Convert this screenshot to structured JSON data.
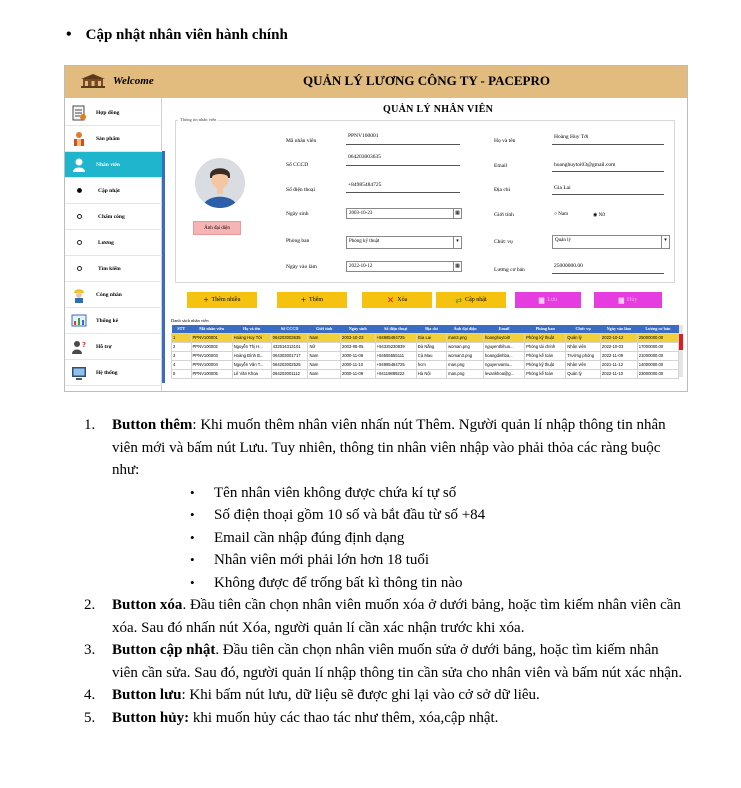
{
  "heading": {
    "bullet": "•",
    "text": "Cập nhật nhân viên hành chính"
  },
  "app": {
    "welcome": "Welcome",
    "title": "QUẢN LÝ LƯƠNG CÔNG TY - PACEPRO",
    "colors": {
      "top_bar": "#e2bb7f",
      "active_item": "#1fb5cc",
      "table_header": "#3b6cc3",
      "selected_row": "#f2d03b"
    },
    "sidebar": {
      "items": [
        {
          "label": "Hợp đồng",
          "icon": "contract-icon"
        },
        {
          "label": "Sản phẩm",
          "icon": "product-icon"
        },
        {
          "label": "Nhân viên",
          "icon": "employee-icon",
          "active": true
        },
        {
          "label": "Cập nhật",
          "sub": true,
          "selected": true
        },
        {
          "label": "Chấm công",
          "sub": true
        },
        {
          "label": "Lương",
          "sub": true
        },
        {
          "label": "Tìm kiếm",
          "sub": true
        },
        {
          "label": "Công nhân",
          "icon": "worker-icon"
        },
        {
          "label": "Thống kê",
          "icon": "statistics-icon"
        },
        {
          "label": "Hỗ trợ",
          "icon": "support-icon"
        },
        {
          "label": "Hệ thống",
          "icon": "system-icon"
        }
      ]
    },
    "main_title": "QUẢN LÝ NHÂN VIÊN",
    "info_caption": "Thông tin nhân viên",
    "avatar_button": "Ảnh đại diện",
    "fields": {
      "ma_nv": {
        "label": "Mã nhân viên",
        "value": "PPNV100001"
      },
      "cccd": {
        "label": "Số CCCD",
        "value": "064203003635"
      },
      "sdt": {
        "label": "Số điện thoại",
        "value": "+84985484725"
      },
      "ngay_sinh": {
        "label": "Ngày sinh",
        "value": "2003-10-23"
      },
      "phong_ban": {
        "label": "Phòng ban",
        "value": "Phòng kỹ thuật"
      },
      "ngay_vao_lam": {
        "label": "Ngày vào làm",
        "value": "2022-10-12"
      },
      "ho_ten": {
        "label": "Họ và tên",
        "value": "Hoàng Huy Tới"
      },
      "email": {
        "label": "Email",
        "value": "hoanghuytoi03@gmail.com"
      },
      "dia_chi": {
        "label": "Địa chỉ",
        "value": "Gia Lai"
      },
      "gioi_tinh": {
        "label": "Giới tính",
        "opt_male": "Nam",
        "opt_female": "Nữ",
        "selected": "Nữ"
      },
      "chuc_vu": {
        "label": "Chức vụ",
        "value": "Quản lý"
      },
      "luong": {
        "label": "Lương cơ bản",
        "value": "25000000.00"
      }
    },
    "buttons": {
      "them_nhieu": "Thêm nhiều",
      "them": "Thêm",
      "xoa": "Xóa",
      "cap_nhat": "Cập nhật",
      "luu": "Lưu",
      "huy": "Hủy"
    },
    "table_caption": "Danh sách nhân viên",
    "table": {
      "headers": [
        "STT",
        "Mã nhân viên",
        "Họ và tên",
        "Số CCCD",
        "Giới tính",
        "Ngày sinh",
        "Số điện thoại",
        "Địa chỉ",
        "Ảnh đại diện",
        "Email",
        "Phòng ban",
        "Chức vụ",
        "Ngày vào làm",
        "Lương cơ bản"
      ],
      "rows": [
        [
          "1",
          "PPNV100001",
          "Hoàng Huy Tới",
          "064203003635",
          "Nam",
          "2003-10-23",
          "+84985484725",
          "Gia Lai",
          "man3.png",
          "hoanghuytoi0",
          "Phòng kỹ thuật",
          "Quản lý",
          "2022-10-12",
          "25000000.00"
        ],
        [
          "2",
          "PPNV100002",
          "Nguyễn Thị H...",
          "432514313101",
          "Nữ",
          "2003-08-05",
          "+84325230839",
          "Đà Nẵng",
          "woman.png",
          "nguyenthihuo...",
          "Phòng tài chính",
          "Nhân viên",
          "2022-10-03",
          "17000000.00"
        ],
        [
          "3",
          "PPNV100003",
          "Hoàng Đình B...",
          "064303001717",
          "Nam",
          "2000-11-09",
          "+84555555111",
          "Cà Mau",
          "woman3.png",
          "hoangdinhba...",
          "Phòng kế toán",
          "Trưởng phòng",
          "2022-11-09",
          "21000000.00"
        ],
        [
          "4",
          "PPNV100004",
          "Nguyễn Văn T...",
          "064203002525",
          "Nam",
          "2000-11-10",
          "+84985484725",
          "hcm",
          "man.png",
          "nguyenvantu...",
          "Phòng kỹ thuật",
          "Nhân viên",
          "2021-11-12",
          "14000000.00"
        ],
        [
          "5",
          "PPNV100005",
          "Lê Văn Khoa",
          "064203001112",
          "Nam",
          "2000-11-09",
          "+84119889222",
          "Hà Nội",
          "man.png",
          "levankhoa@g...",
          "Phòng kế toán",
          "Quản lý",
          "2022-11-10",
          "23000000.00"
        ]
      ]
    }
  },
  "description": {
    "items": [
      {
        "num": "1.",
        "bold": "Button thêm",
        "text": ": Khi muốn thêm nhân viên nhấn nút Thêm. Người quản lí nhập thông tin nhân viên mới và bấm nút Lưu. Tuy nhiên, thông tin nhân viên nhập vào phải thỏa các ràng buộc như:",
        "sub": [
          "Tên nhân viên không được chứa kí tự số",
          "Số điện thoại gồm 10 số và bắt đầu từ số +84",
          "Email cần nhập đúng định dạng",
          "Nhân viên mới phải lớn hơn 18 tuổi",
          "Không được để trống bất kì thông tin nào"
        ]
      },
      {
        "num": "2.",
        "bold": "Button xóa",
        "text": ". Đầu tiên cần chọn nhân viên muốn xóa ở dưới bảng, hoặc tìm kiếm nhân viên cần xóa. Sau đó nhấn nút Xóa, người quản lí cần xác nhận trước khi xóa."
      },
      {
        "num": "3.",
        "bold": "Button cập nhật",
        "text": ". Đầu tiên cần chọn nhân viên muốn sửa ở dưới bảng, hoặc tìm kiếm nhân viên cần sửa. Sau đó, người quản lí nhập thông tin cần sửa cho nhân viên và bấm nút xác nhận."
      },
      {
        "num": "4.",
        "bold": "Button lưu",
        "text": ": Khi bấm nút lưu, dữ liệu sẽ được ghi lại vào cở sở dữ liêu."
      },
      {
        "num": "5.",
        "bold": "Button hủy:",
        "text": " khi muốn hủy các thao tác như thêm, xóa,cập nhật."
      }
    ],
    "sub_bullet": "•"
  }
}
